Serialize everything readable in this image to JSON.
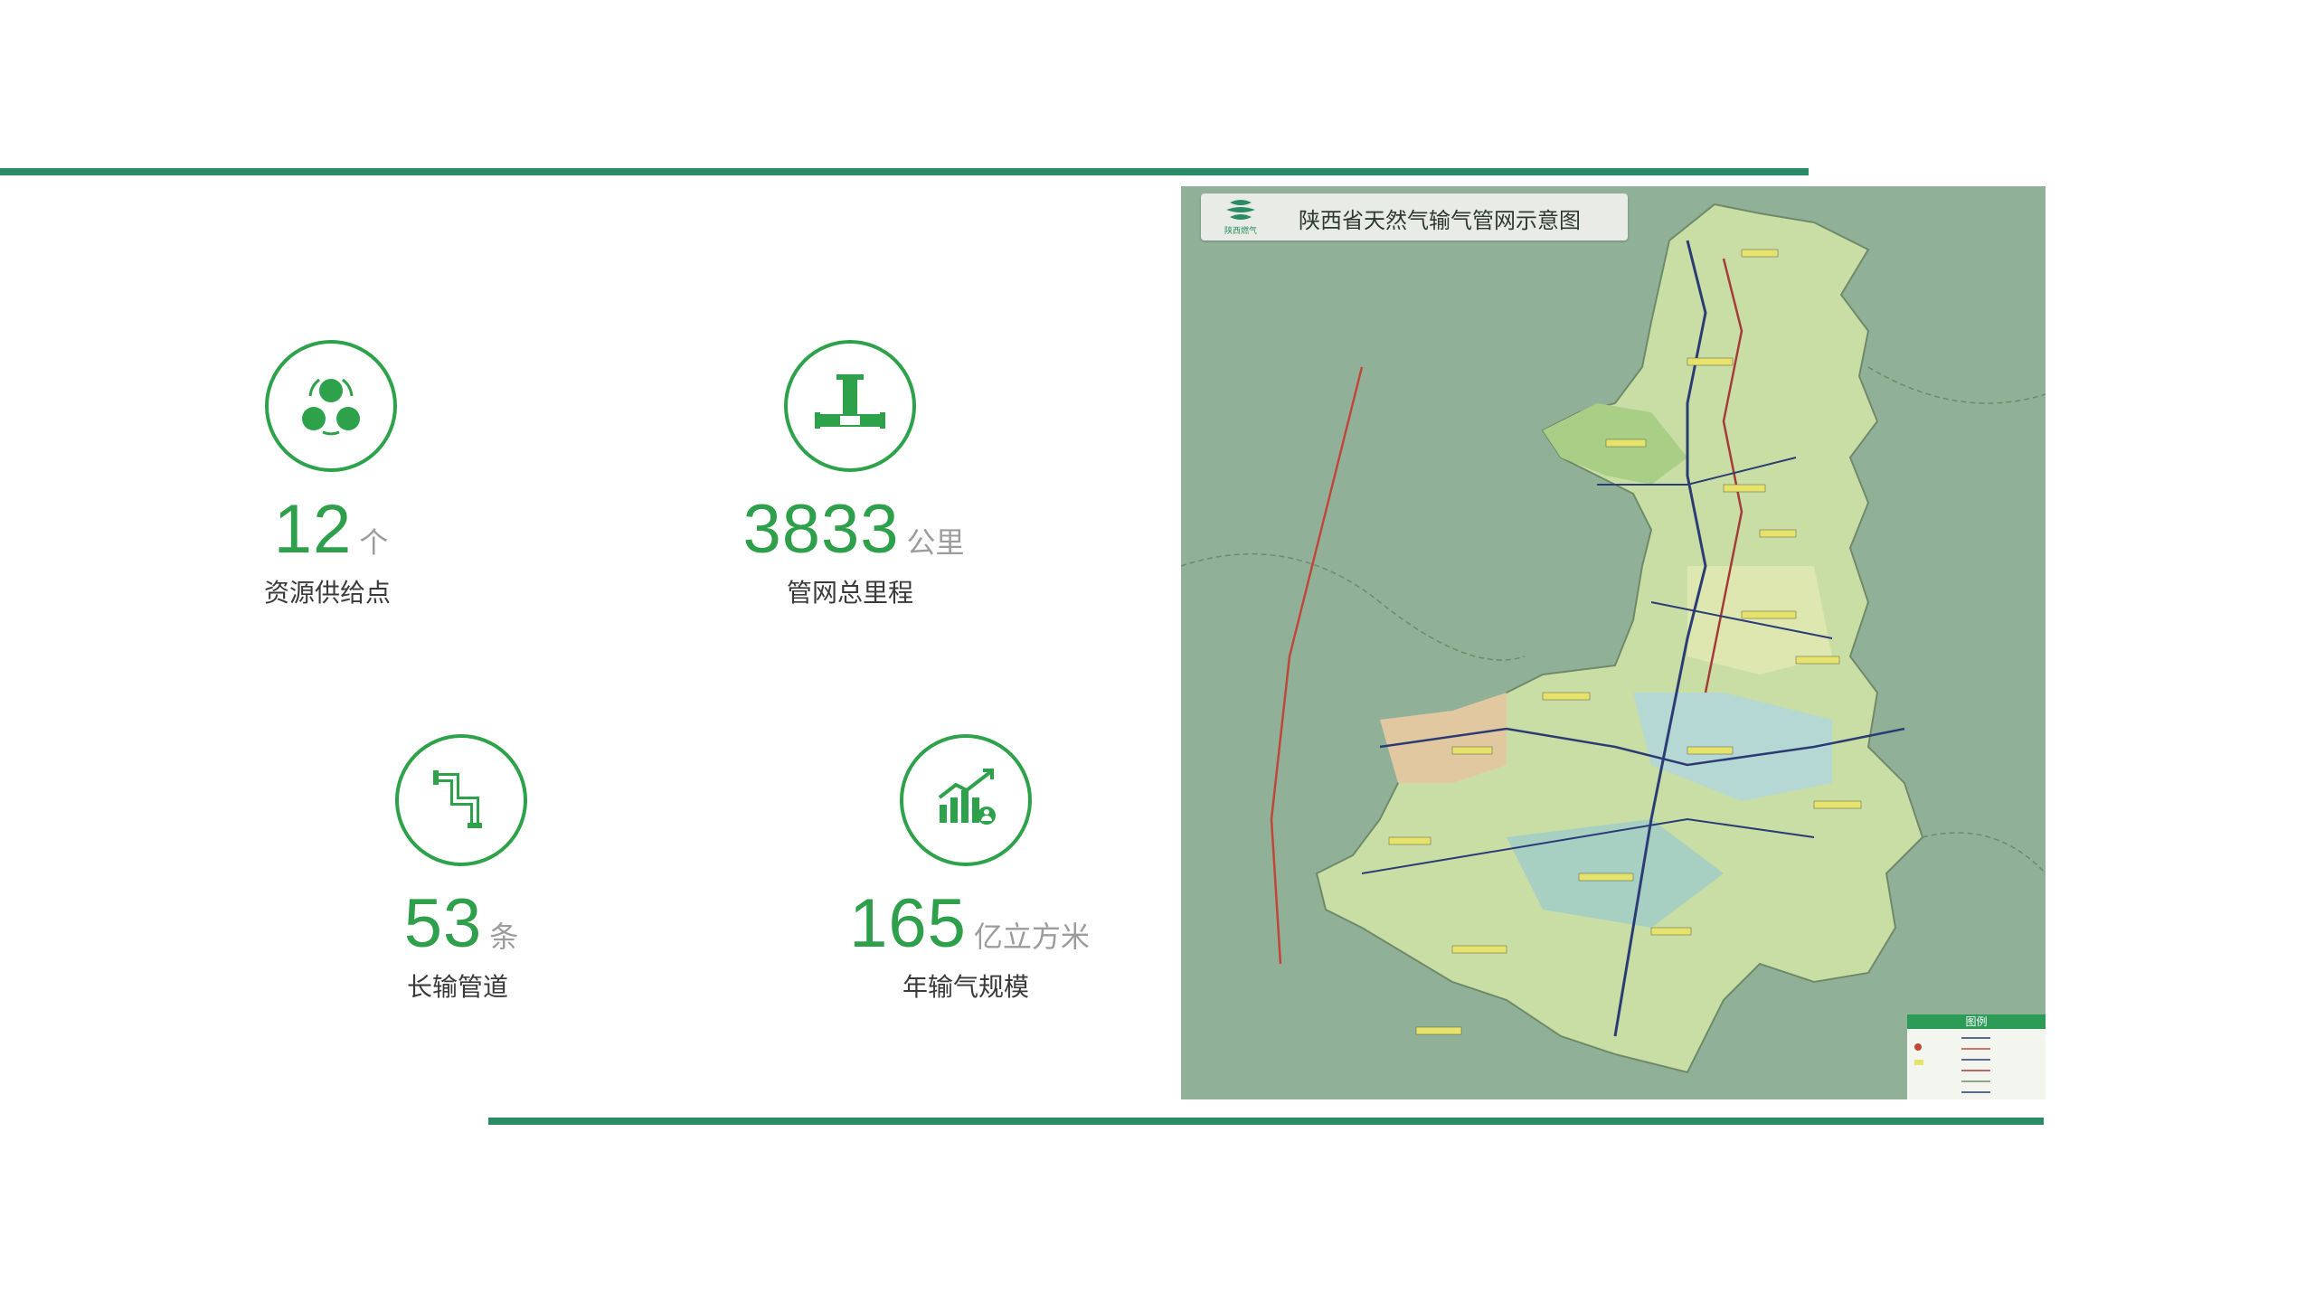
{
  "stats": [
    {
      "value": "12",
      "unit": "个",
      "label": "资源供给点",
      "icon": "resource-nodes-icon"
    },
    {
      "value": "3833",
      "unit": "公里",
      "label": "管网总里程",
      "icon": "pipe-valve-icon"
    },
    {
      "value": "53",
      "unit": "条",
      "label": "长输管道",
      "icon": "pipe-elbow-icon"
    },
    {
      "value": "165",
      "unit": "亿立方米",
      "label": "年输气规模",
      "icon": "growth-chart-icon"
    }
  ],
  "map": {
    "title": "陕西省天然气输气管网示意图",
    "logo_text": "陕西燃气",
    "legend_title": "图例"
  },
  "colors": {
    "accent_green": "#2e9f4a",
    "rule_green": "#2a8c62",
    "label_gray": "#3a3a3a",
    "unit_gray": "#9c9c9c"
  }
}
